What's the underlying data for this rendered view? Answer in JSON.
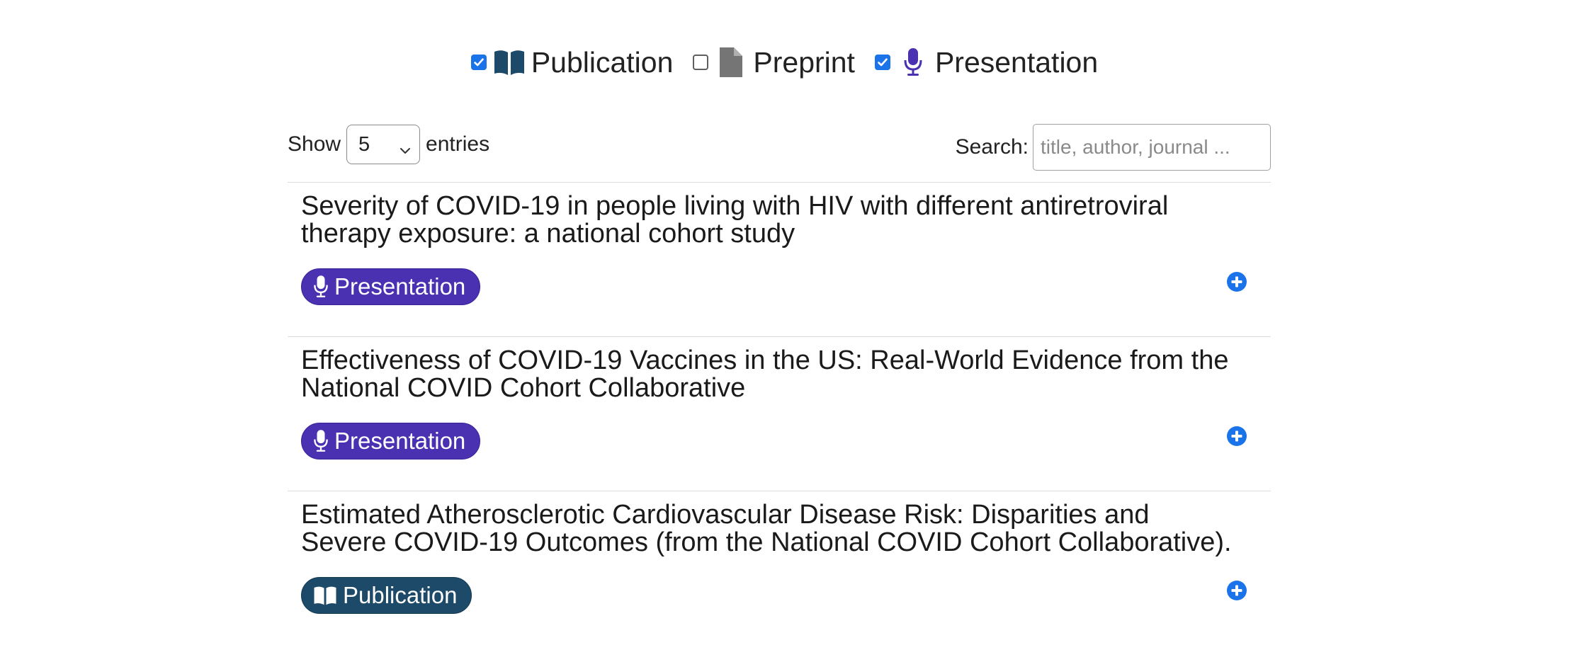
{
  "filters": [
    {
      "label": "Publication",
      "checked": true,
      "icon": "book-open-icon",
      "icon_color": "#1d4a68"
    },
    {
      "label": "Preprint",
      "checked": false,
      "icon": "file-icon",
      "icon_color": "#757575"
    },
    {
      "label": "Presentation",
      "checked": true,
      "icon": "microphone-icon",
      "icon_color": "#4a31b1"
    }
  ],
  "length_control": {
    "prefix": "Show",
    "selected": "5",
    "suffix": "entries"
  },
  "search": {
    "label": "Search:",
    "placeholder": "title, author, journal ...",
    "value": ""
  },
  "entries": [
    {
      "title": "Severity of COVID-19 in people living with HIV with different antiretroviral therapy exposure: a national cohort study",
      "type": "Presentation",
      "icon": "microphone-icon"
    },
    {
      "title": "Effectiveness of COVID-19 Vaccines in the US: Real-World Evidence from the National COVID Cohort Collaborative",
      "type": "Presentation",
      "icon": "microphone-icon"
    },
    {
      "title": "Estimated Atherosclerotic Cardiovascular Disease Risk: Disparities and Severe COVID-19 Outcomes (from the National COVID Cohort Collaborative).",
      "type": "Publication",
      "icon": "book-open-icon"
    }
  ],
  "colors": {
    "presentation": "#4a31b1",
    "publication": "#1d4a68",
    "checkbox_accent": "#1a73e8",
    "expand_icon": "#1a73e8"
  }
}
